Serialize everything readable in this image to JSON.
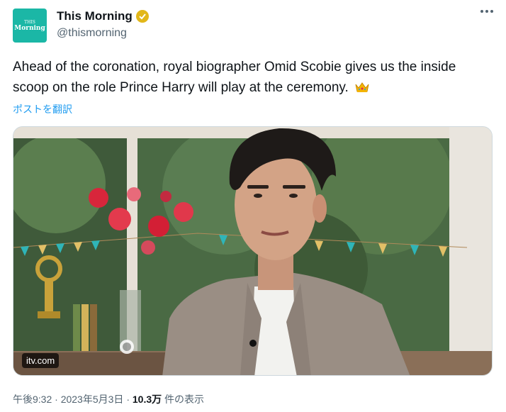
{
  "account": {
    "display_name": "This Morning",
    "handle": "@thismorning",
    "avatar_text_top": "THIS",
    "avatar_text_bottom": "Morning",
    "verified_color": "#e2b719"
  },
  "tweet": {
    "text": "Ahead of the coronation, royal biographer Omid Scobie gives us the inside scoop on the role Prince Harry will play at the ceremony.",
    "emoji": "crown-icon",
    "translate_label": "ポストを翻訳"
  },
  "media": {
    "badge": "itv.com"
  },
  "meta": {
    "time": "午後9:32",
    "separator": "·",
    "date": "2023年5月3日",
    "views_count": "10.3万",
    "views_label": "件の表示"
  },
  "colors": {
    "accent": "#1d9bf0",
    "brand": "#1bb7a6"
  }
}
